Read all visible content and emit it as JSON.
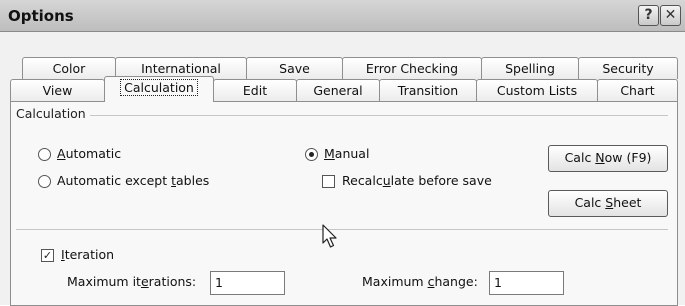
{
  "window": {
    "title": "Options",
    "help_label": "?",
    "close_label": "✕"
  },
  "tabs_row1": [
    "Color",
    "International",
    "Save",
    "Error Checking",
    "Spelling",
    "Security"
  ],
  "tabs_row2": [
    "View",
    "Calculation",
    "Edit",
    "General",
    "Transition",
    "Custom Lists",
    "Chart"
  ],
  "active_tab": "Calculation",
  "calculation": {
    "group_label": "Calculation",
    "automatic": {
      "pre": "",
      "key": "A",
      "post": "utomatic",
      "selected": false
    },
    "automatic_except": {
      "pre": "Automatic except ",
      "key": "t",
      "post": "ables",
      "selected": false
    },
    "manual": {
      "pre": "",
      "key": "M",
      "post": "anual",
      "selected": true
    },
    "recalc": {
      "pre": "Recalc",
      "key": "u",
      "post": "late before save",
      "checked": false
    },
    "calc_now": {
      "pre": "Calc ",
      "key": "N",
      "post": "ow (F9)"
    },
    "calc_sheet": {
      "pre": "Calc ",
      "key": "S",
      "post": "heet"
    }
  },
  "iteration": {
    "checkbox": {
      "pre": "",
      "key": "I",
      "post": "teration",
      "checked": true
    },
    "max_iterations": {
      "pre": "Maximum it",
      "key": "e",
      "post": "rations:",
      "value": "1"
    },
    "max_change": {
      "pre": "Maximum ",
      "key": "c",
      "post": "hange:",
      "value": "1"
    }
  }
}
